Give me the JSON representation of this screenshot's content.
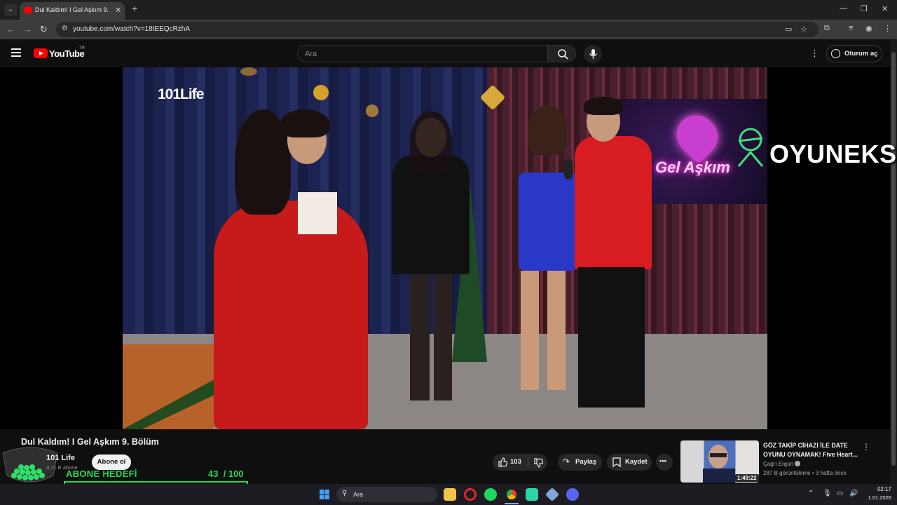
{
  "browser": {
    "tab_title": "Dul Kaldım! I Gel Aşkım 9. Bölüm",
    "new_tab": "+",
    "url": "youtube.com/watch?v=18tEEQcRzhA",
    "window_controls": [
      "—",
      "❐",
      "✕"
    ]
  },
  "header": {
    "logo_text": "YouTube",
    "region": "TR",
    "search_placeholder": "Ara",
    "signin_label": "Oturum aç"
  },
  "video": {
    "brand_logo": "101Life",
    "set_sign": "Gel Aşkım",
    "watermark": "OYUNEKS"
  },
  "info": {
    "title": "Dul Kaldım! I Gel Aşkım 9. Bölüm",
    "channel_name": "101 Life",
    "channel_subs": "3,71 B abone",
    "subscribe_label": "Abone ol",
    "like_count": "103",
    "share_label": "Paylaş",
    "save_label": "Kaydet",
    "more_label": "•••"
  },
  "subscriber_goal": {
    "label": "ABONE HEDEFİ",
    "current": "43",
    "target": "/ 100",
    "progress_fraction": 0.43
  },
  "recommendation": {
    "title": "GÖZ TAKİP CİHAZI İLE DATE OYUNU OYNAMAK! Five Heart...",
    "channel": "Çağrı Ergün",
    "meta": "287 B görüntüleme • 3 hafta önce",
    "duration": "1:49:22"
  },
  "taskbar": {
    "search_label": "Ara",
    "time": "02:17",
    "date": "1.01.2026"
  },
  "colors": {
    "accent_red": "#ff0000",
    "goal_green": "#20e05a"
  }
}
